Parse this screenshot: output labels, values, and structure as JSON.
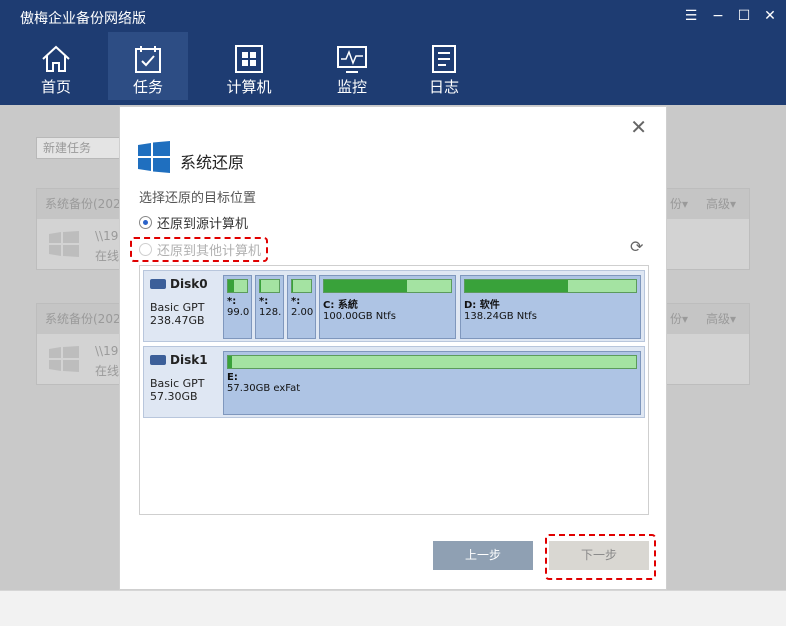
{
  "app": {
    "title": "傲梅企业备份网络版"
  },
  "window_controls": {
    "menu": "☰",
    "minimize": "−",
    "maximize": "☐",
    "close": "✕"
  },
  "nav": [
    {
      "label": "首页",
      "icon": "home-icon"
    },
    {
      "label": "任务",
      "icon": "task-icon"
    },
    {
      "label": "计算机",
      "icon": "computer-icon"
    },
    {
      "label": "监控",
      "icon": "monitor-icon"
    },
    {
      "label": "日志",
      "icon": "log-icon"
    }
  ],
  "background": {
    "new_task_select": "新建任务",
    "cards": [
      {
        "title": "系统备份(202",
        "more": "份▾",
        "advanced": "高级▾",
        "path": "\\\\192",
        "status": "在线"
      },
      {
        "title": "系统备份(202",
        "more": "份▾",
        "advanced": "高级▾",
        "path": "\\\\192",
        "status": "在线"
      }
    ]
  },
  "dialog": {
    "title": "系统还原",
    "subtitle": "选择还原的目标位置",
    "option_source": "还原到源计算机",
    "option_other": "还原到其他计算机",
    "disks": [
      {
        "name": "Disk0",
        "type": "Basic GPT",
        "size": "238.47GB",
        "partitions": [
          {
            "label": "*:",
            "size": "99.0",
            "used": 0.3
          },
          {
            "label": "*:",
            "size": "128.",
            "used": 0.05
          },
          {
            "label": "*:",
            "size": "2.00",
            "used": 0.05
          },
          {
            "label": "C: 系統",
            "size": "100.00GB Ntfs",
            "used": 0.65
          },
          {
            "label": "D: 软件",
            "size": "138.24GB Ntfs",
            "used": 0.6
          }
        ]
      },
      {
        "name": "Disk1",
        "type": "Basic GPT",
        "size": "57.30GB",
        "partitions": [
          {
            "label": "E:",
            "size": "57.30GB exFat",
            "used": 0.01
          }
        ]
      }
    ],
    "prev_button": "上一步",
    "next_button": "下一步"
  }
}
